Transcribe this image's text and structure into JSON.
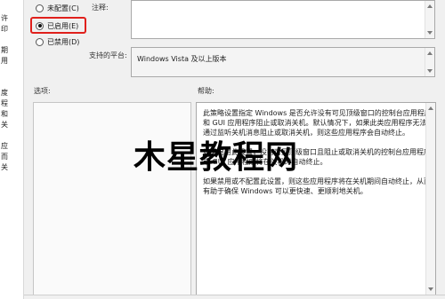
{
  "left_strip_fragments": [
    "许",
    "印",
    "期",
    "用",
    "度",
    "程",
    "和",
    "关",
    "应",
    "而",
    "关"
  ],
  "state_options": [
    {
      "label": "未配置(C)",
      "checked": false
    },
    {
      "label": "已启用(E)",
      "checked": true
    },
    {
      "label": "已禁用(D)",
      "checked": false
    }
  ],
  "comment_label": "注释:",
  "supported_platforms_label": "支持的平台:",
  "supported_platforms_value": "Windows Vista 及以上版本",
  "options_label": "选项:",
  "help_label": "帮助:",
  "help_paragraphs": [
    "此策略设置指定 Windows 是否允许没有可见顶级窗口的控制台应用程序和 GUI 应用程序阻止或取消关机。默认情况下，如果此类应用程序无法通过监听关机消息阻止或取消关机，则这些应用程序会自动终止。",
    "如果启用此设置，没有可见顶级窗口且阻止或取消关机的控制台应用程序或 GUI 应用程序将在关机时自动终止。",
    "如果禁用或不配置此设置，则这些应用程序将在关机期间自动终止，从而有助于确保 Windows 可以更快速、更顺利地关机。"
  ],
  "watermark": "木星教程网",
  "colors": {
    "highlight": "#e0201c",
    "background": "#f0f0f0",
    "box_border": "#a9a9a9"
  }
}
